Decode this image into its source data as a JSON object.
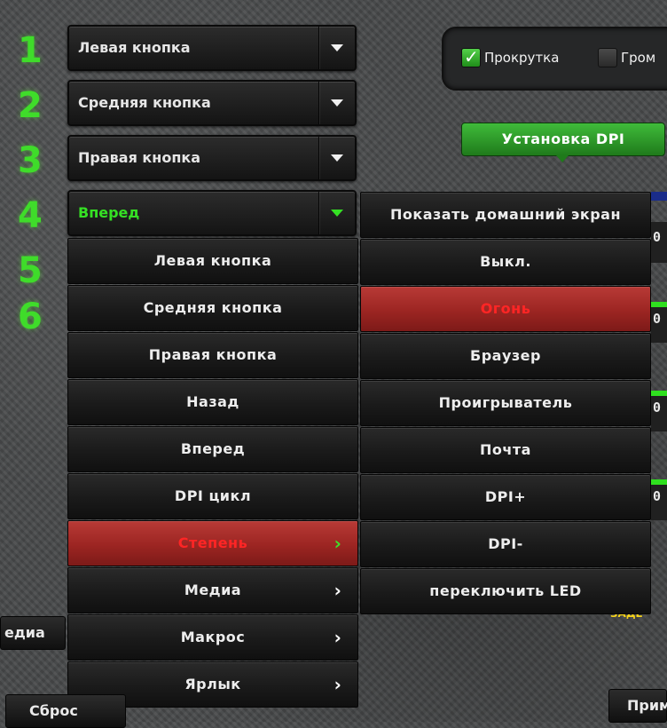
{
  "slot_numbers": [
    "1",
    "2",
    "3",
    "4",
    "5",
    "6"
  ],
  "dropdowns": [
    {
      "label": "Левая кнопка"
    },
    {
      "label": "Средняя кнопка"
    },
    {
      "label": "Правая кнопка"
    },
    {
      "label": "Вперед"
    }
  ],
  "colors": {
    "accent_green": "#35e024",
    "selected_red": "#9c2522",
    "selected_text": "#ff2525"
  },
  "scroll_checkbox": {
    "label": "Прокрутка",
    "checked": true
  },
  "volume_checkbox": {
    "label": "Гром",
    "checked": false
  },
  "dpi_button": "Установка DPI",
  "menu": [
    {
      "label": "Левая кнопка"
    },
    {
      "label": "Средняя кнопка"
    },
    {
      "label": "Правая кнопка"
    },
    {
      "label": "Назад"
    },
    {
      "label": "Вперед"
    },
    {
      "label": "DPI цикл"
    },
    {
      "label": "Степень",
      "selected": true,
      "has_submenu": true
    },
    {
      "label": "Медиа",
      "has_submenu": true
    },
    {
      "label": "Макрос",
      "has_submenu": true
    },
    {
      "label": "Ярлык",
      "has_submenu": true
    }
  ],
  "submenu_arrow": "›",
  "submenu": [
    {
      "label": "Показать домашний экран"
    },
    {
      "label": "Выкл."
    },
    {
      "label": "Огонь",
      "selected": true
    },
    {
      "label": "Браузер"
    },
    {
      "label": "Проигрыватель"
    },
    {
      "label": "Почта"
    },
    {
      "label": "DPI+"
    },
    {
      "label": "DPI-"
    },
    {
      "label": "переключить LED"
    }
  ],
  "edge_values": [
    "0",
    "0",
    "0",
    "0"
  ],
  "yellow_text": "ЗАДЕ",
  "left_media_button": "едиа",
  "reset_button": "Сброс",
  "apply_button": "Прим"
}
